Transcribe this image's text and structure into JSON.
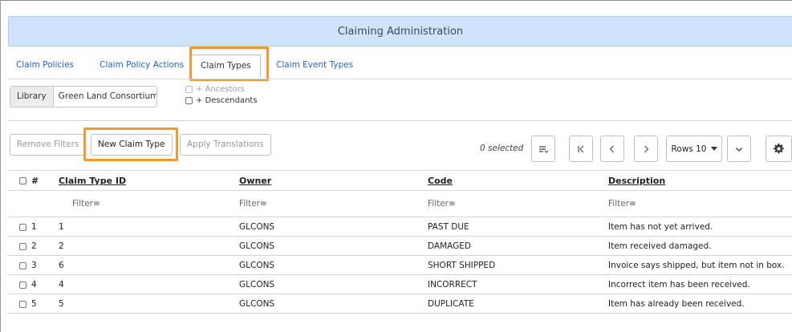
{
  "title": "Claiming Administration",
  "tabs": [
    {
      "label": "Claim Policies"
    },
    {
      "label": "Claim Policy Actions"
    },
    {
      "label": "Claim Types"
    },
    {
      "label": "Claim Event Types"
    }
  ],
  "library": {
    "label": "Library",
    "value": "Green Land Consortium (G",
    "ancestors_label": "+ Ancestors",
    "descendants_label": "+ Descendants"
  },
  "toolbar": {
    "remove_filters": "Remove Filters",
    "new_claim_type": "New Claim Type",
    "apply_translations": "Apply Translations",
    "selected_text": "0 selected",
    "rows_label": "Rows 10",
    "icons": [
      "columns-menu-icon",
      "first-page-icon",
      "previous-page-icon",
      "next-page-icon",
      "expand-chevron-icon",
      "gear-icon"
    ]
  },
  "table": {
    "headers": {
      "num": "#",
      "id": "Claim Type ID",
      "owner": "Owner",
      "code": "Code",
      "description": "Description"
    },
    "filter_label": "Filter",
    "rows": [
      {
        "num": "1",
        "id": "1",
        "owner": "GLCONS",
        "code": "PAST DUE",
        "description": "Item has not yet arrived."
      },
      {
        "num": "2",
        "id": "2",
        "owner": "GLCONS",
        "code": "DAMAGED",
        "description": "Item received damaged."
      },
      {
        "num": "3",
        "id": "6",
        "owner": "GLCONS",
        "code": "SHORT SHIPPED",
        "description": "Invoice says shipped, but item not in box."
      },
      {
        "num": "4",
        "id": "4",
        "owner": "GLCONS",
        "code": "INCORRECT",
        "description": "Incorrect item has been received."
      },
      {
        "num": "5",
        "id": "5",
        "owner": "GLCONS",
        "code": "DUPLICATE",
        "description": "Item has already been received."
      }
    ]
  },
  "colors": {
    "title_bar": "#cfe3fb",
    "link": "#2166c4",
    "highlight": "#f39a2e"
  }
}
